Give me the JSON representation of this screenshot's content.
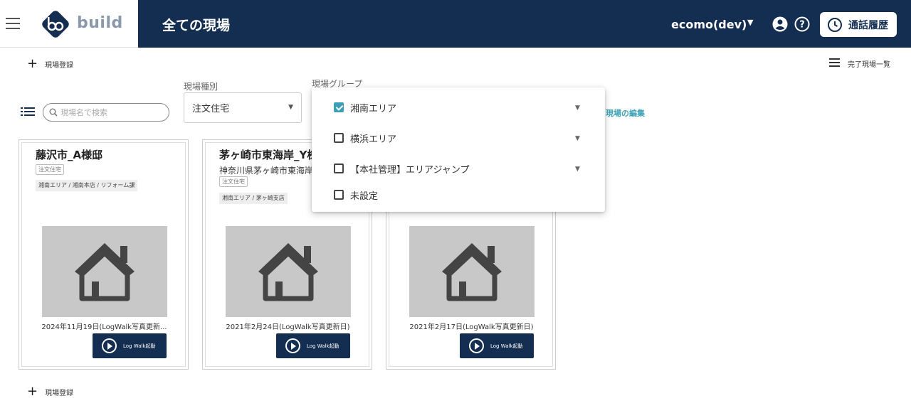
{
  "header": {
    "title": "全ての現場",
    "logo_text": "build",
    "account_name": "ecomo(dev)",
    "history_button": "通話履歴",
    "bg_color": "#142e52"
  },
  "toolbar": {
    "register_top": "現場登録",
    "completed_list": "完了現場一覧",
    "search_placeholder": "現場名で検索",
    "type_label": "現場種別",
    "type_value": "注文住宅",
    "group_label": "現場グループ",
    "group_edit_link": "現場の編集",
    "register_bottom": "現場登録"
  },
  "group_dropdown": {
    "items": [
      {
        "label": "湘南エリア",
        "checked": true,
        "expandable": true
      },
      {
        "label": "横浜エリア",
        "checked": false,
        "expandable": true
      },
      {
        "label": "【本社管理】エリアジャンプ",
        "checked": false,
        "expandable": true
      },
      {
        "label": "未設定",
        "checked": false,
        "expandable": false
      }
    ]
  },
  "cards": [
    {
      "title": "藤沢市_A様邸",
      "address": "",
      "type_tag": "注文住宅",
      "area_tag": "湘南エリア / 湘南本店 / リフォーム課",
      "date": "2024年11月19日(LogWalk写真更新...",
      "button": "Log Walk起動"
    },
    {
      "title": "茅ヶ崎市東海岸_Y様邸",
      "address": "神奈川県茅ヶ崎市東海岸",
      "type_tag": "注文住宅",
      "area_tag": "湘南エリア / 茅ヶ崎支店",
      "date": "2021年2月24日(LogWalk写真更新日)",
      "button": "Log Walk起動"
    },
    {
      "title": "",
      "address": "",
      "type_tag": "",
      "area_tag": "",
      "date": "2021年2月17日(LogWalk写真更新日)",
      "button": "Log Walk起動"
    }
  ]
}
